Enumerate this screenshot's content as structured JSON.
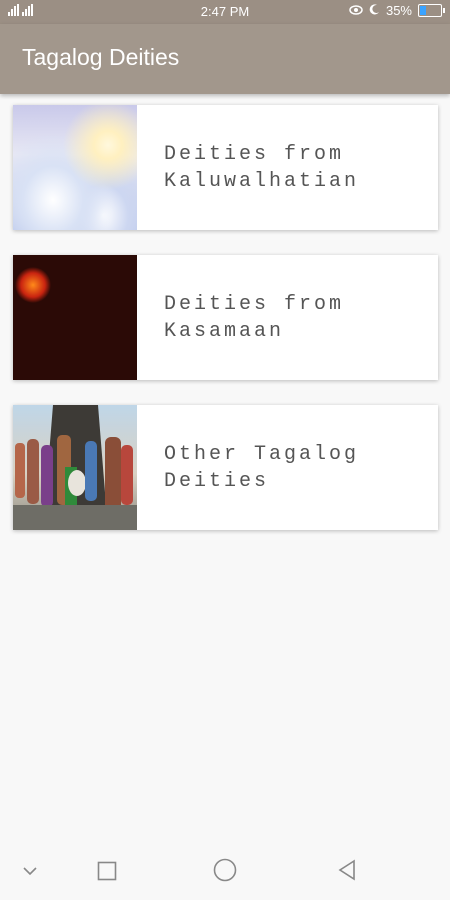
{
  "status_bar": {
    "time": "2:47 PM",
    "battery_percent": "35%",
    "battery_level": 0.35,
    "icons": [
      "signal-icon",
      "signal-icon",
      "eye-icon",
      "moon-icon",
      "battery-icon"
    ]
  },
  "app_bar": {
    "title": "Tagalog Deities"
  },
  "cards": [
    {
      "label_line1": "Deities from",
      "label_line2": "Kaluwalhatian",
      "image": "clouds-image"
    },
    {
      "label_line1": "Deities from",
      "label_line2": "Kasamaan",
      "image": "lava-image"
    },
    {
      "label_line1": "Other Tagalog",
      "label_line2": "Deities",
      "image": "deities-group-image"
    }
  ],
  "nav_bar": {
    "icons": [
      "chevron-down-icon",
      "recents-icon",
      "home-icon",
      "back-icon"
    ]
  },
  "colors": {
    "app_bar": "#a2978c",
    "status_bar": "#9b8f84",
    "background": "#f8f8f8",
    "card_text": "#555555"
  }
}
